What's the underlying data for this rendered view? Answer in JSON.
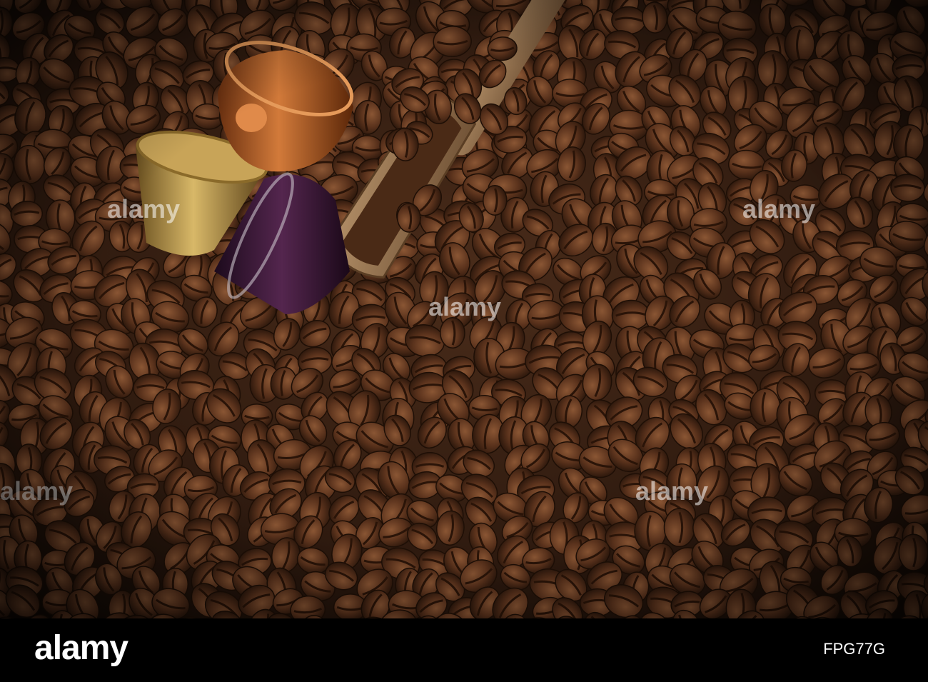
{
  "watermark": {
    "text": "alamy"
  },
  "footer": {
    "brand": "alamy",
    "image_id": "FPG77G"
  },
  "colors": {
    "background_beans": "#3a2418",
    "bean_light": "#6e4226",
    "capsule_copper": "#b8642c",
    "capsule_gold": "#b08a3c",
    "capsule_purple": "#3c1b3a",
    "scoop_wood": "#8c6a44",
    "footer_bg": "#000000"
  }
}
